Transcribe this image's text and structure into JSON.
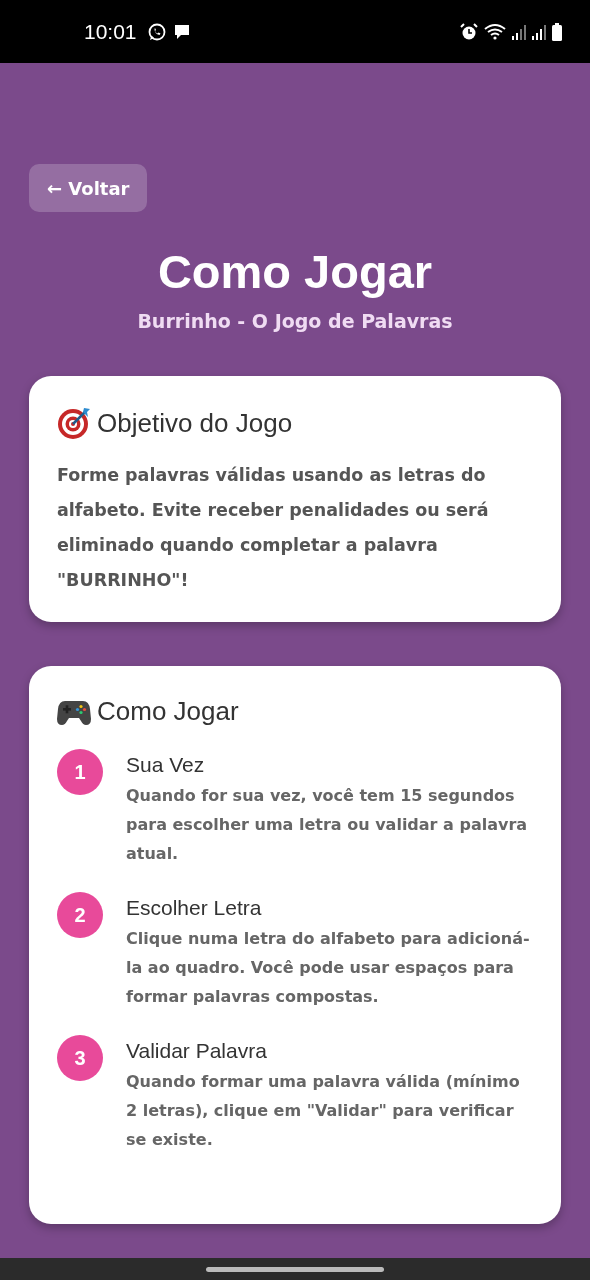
{
  "status_bar": {
    "time": "10:01"
  },
  "back_button": {
    "arrow": "←",
    "label": "Voltar"
  },
  "title": "Como Jogar",
  "subtitle": "Burrinho - O Jogo de Palavras",
  "sections": [
    {
      "title": "Objetivo do Jogo",
      "text": "Forme palavras válidas usando as letras do alfabeto. Evite receber penalidades ou será eliminado quando completar a palavra \"BURRINHO\"!"
    },
    {
      "title": "Como Jogar",
      "steps": [
        {
          "number": "1",
          "title": "Sua Vez",
          "text": "Quando for sua vez, você tem 15 segundos para escolher uma letra ou validar a palavra atual."
        },
        {
          "number": "2",
          "title": "Escolher Letra",
          "text": "Clique numa letra do alfabeto para adicioná-la ao quadro. Você pode usar espaços para formar palavras compostas."
        },
        {
          "number": "3",
          "title": "Validar Palavra",
          "text": "Quando formar uma palavra válida (mínimo 2 letras), clique em \"Validar\" para verificar se existe."
        }
      ]
    }
  ]
}
